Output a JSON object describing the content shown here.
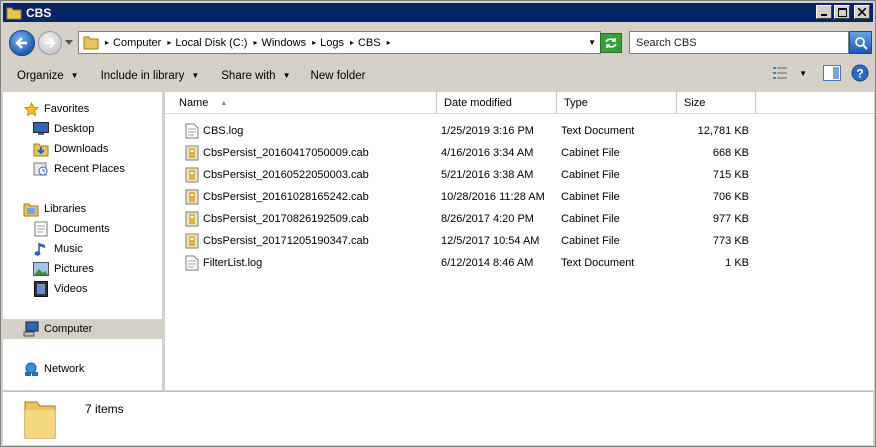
{
  "window": {
    "title": "CBS"
  },
  "address": {
    "crumbs": [
      "Computer",
      "Local Disk (C:)",
      "Windows",
      "Logs",
      "CBS"
    ]
  },
  "search": {
    "placeholder": "Search CBS"
  },
  "toolbar": {
    "organize": "Organize",
    "include_in_library": "Include in library",
    "share_with": "Share with",
    "new_folder": "New folder"
  },
  "nav": {
    "favorites": "Favorites",
    "desktop": "Desktop",
    "downloads": "Downloads",
    "recent_places": "Recent Places",
    "libraries": "Libraries",
    "documents": "Documents",
    "music": "Music",
    "pictures": "Pictures",
    "videos": "Videos",
    "computer": "Computer",
    "network": "Network"
  },
  "columns": {
    "name": "Name",
    "date": "Date modified",
    "type": "Type",
    "size": "Size"
  },
  "files": [
    {
      "name": "CBS.log",
      "date": "1/25/2019 3:16 PM",
      "type": "Text Document",
      "size": "12,781 KB",
      "icon": "text-file-icon"
    },
    {
      "name": "CbsPersist_20160417050009.cab",
      "date": "4/16/2016 3:34 AM",
      "type": "Cabinet File",
      "size": "668 KB",
      "icon": "cabinet-file-icon"
    },
    {
      "name": "CbsPersist_20160522050003.cab",
      "date": "5/21/2016 3:38 AM",
      "type": "Cabinet File",
      "size": "715 KB",
      "icon": "cabinet-file-icon"
    },
    {
      "name": "CbsPersist_20161028165242.cab",
      "date": "10/28/2016 11:28 AM",
      "type": "Cabinet File",
      "size": "706 KB",
      "icon": "cabinet-file-icon"
    },
    {
      "name": "CbsPersist_20170826192509.cab",
      "date": "8/26/2017 4:20 PM",
      "type": "Cabinet File",
      "size": "977 KB",
      "icon": "cabinet-file-icon"
    },
    {
      "name": "CbsPersist_20171205190347.cab",
      "date": "12/5/2017 10:54 AM",
      "type": "Cabinet File",
      "size": "773 KB",
      "icon": "cabinet-file-icon"
    },
    {
      "name": "FilterList.log",
      "date": "6/12/2014 8:46 AM",
      "type": "Text Document",
      "size": "1 KB",
      "icon": "text-file-icon"
    }
  ],
  "status": {
    "item_count": "7 items"
  },
  "colors": {
    "titlebar": "#0a246a",
    "window_bg": "#d4d0c8"
  }
}
